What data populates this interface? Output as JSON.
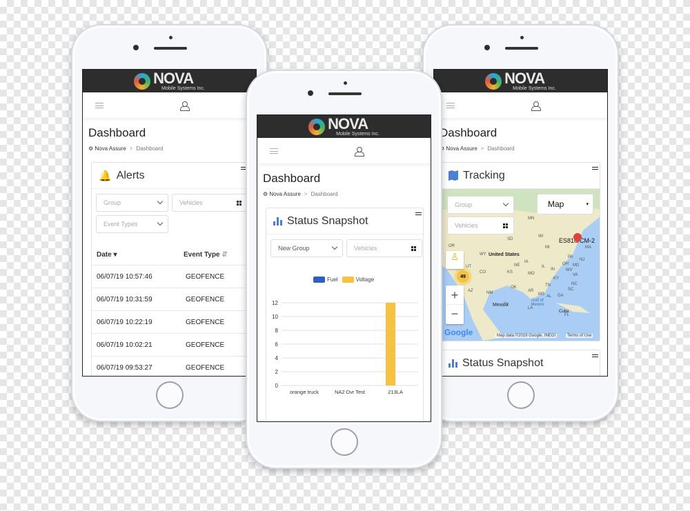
{
  "brand": {
    "name": "NOVA",
    "tagline": "Mobile Systems Inc."
  },
  "colors": {
    "header": "#2d2d2d",
    "accent_blue": "#4a7fd4",
    "fuel": "#2f5fc4",
    "voltage": "#f5c242"
  },
  "left_phone": {
    "page_title": "Dashboard",
    "breadcrumb": {
      "root": "Nova Assure",
      "separator": ">",
      "current": "Dashboard"
    },
    "card_title": "Alerts",
    "filters": {
      "group": "Group",
      "vehicles": "Vehicles",
      "event_types": "Event Types"
    },
    "table": {
      "columns": [
        "Date",
        "Event Type"
      ],
      "rows": [
        {
          "date": "06/07/19 10:57:46",
          "event": "GEOFENCE"
        },
        {
          "date": "06/07/19 10:31:59",
          "event": "GEOFENCE"
        },
        {
          "date": "06/07/19 10:22:19",
          "event": "GEOFENCE"
        },
        {
          "date": "06/07/19 10:02:21",
          "event": "GEOFENCE"
        },
        {
          "date": "06/07/19 09:53:27",
          "event": "GEOFENCE"
        }
      ]
    }
  },
  "center_phone": {
    "page_title": "Dashboard",
    "breadcrumb": {
      "root": "Nova Assure",
      "separator": ">",
      "current": "Dashboard"
    },
    "card_title": "Status Snapshot",
    "filters": {
      "group": "New Group",
      "vehicles": "Vehicles"
    }
  },
  "chart_data": {
    "type": "bar",
    "title": "",
    "categories": [
      "orange truck",
      "NA2 Dvr Test",
      "213LA"
    ],
    "series": [
      {
        "name": "Fuel",
        "values": [
          0,
          0,
          0
        ]
      },
      {
        "name": "Voltage",
        "values": [
          0,
          0,
          12
        ]
      }
    ],
    "ylim": [
      0,
      12
    ],
    "yticks": [
      "0",
      "2",
      "4",
      "6",
      "8",
      "10",
      "12"
    ],
    "grid": true,
    "legend": "top"
  },
  "right_phone": {
    "page_title": "Dashboard",
    "breadcrumb": {
      "root": "Nova Assure",
      "separator": ">",
      "current": "Dashboard"
    },
    "card_title": "Tracking",
    "filters": {
      "group": "Group",
      "vehicles": "Vehicles",
      "map_type": "Map"
    },
    "map": {
      "marker_label": "ES810-CM-2",
      "cluster_count": "49",
      "country_us": "United States",
      "country_mx": "Mexico",
      "gulf": "Gulf of Mexico",
      "cuba": "Cuba",
      "provider": "Google",
      "attribution": "Map data ©2019 Google, INEGI",
      "terms": "Terms of Use",
      "states": [
        "OR",
        "WY",
        "SD",
        "MN",
        "WI",
        "MI",
        "NE",
        "IA",
        "UT",
        "CO",
        "KS",
        "MO",
        "IL",
        "IN",
        "OH",
        "PA",
        "AZ",
        "NM",
        "OK",
        "AR",
        "TN",
        "KY",
        "WV",
        "VA",
        "NC",
        "TX",
        "MS",
        "AL",
        "GA",
        "SC",
        "LA",
        "FL",
        "MA",
        "MD",
        "NJ"
      ]
    },
    "second_card_title": "Status Snapshot"
  }
}
